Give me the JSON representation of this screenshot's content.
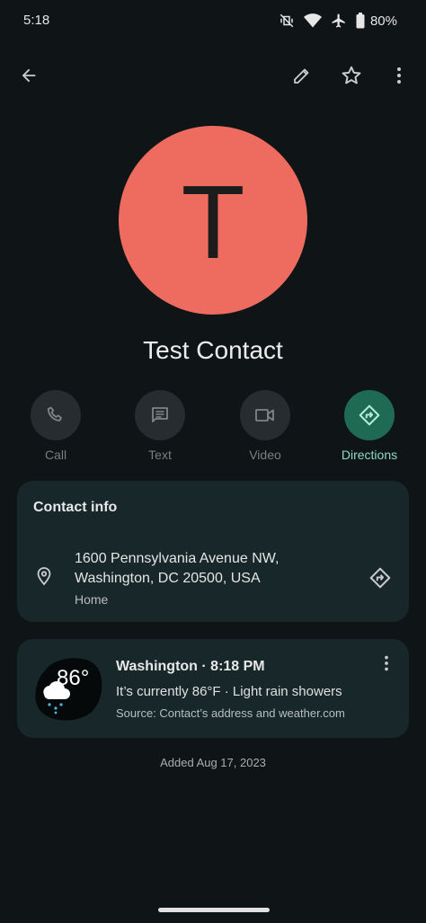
{
  "status_bar": {
    "time": "5:18",
    "battery": "80%"
  },
  "top_bar": {
    "back_icon": "arrow-back-icon",
    "edit_icon": "pencil-icon",
    "star_icon": "star-outline-icon",
    "more_icon": "more-vert-icon"
  },
  "contact": {
    "initial": "T",
    "name": "Test Contact",
    "avatar_color": "#ee6b5f"
  },
  "actions": [
    {
      "label": "Call",
      "icon": "phone-icon"
    },
    {
      "label": "Text",
      "icon": "message-icon"
    },
    {
      "label": "Video",
      "icon": "videocam-icon"
    },
    {
      "label": "Directions",
      "icon": "directions-icon",
      "active": true
    }
  ],
  "contact_info": {
    "title": "Contact info",
    "address_line1": "1600 Pennsylvania Avenue NW,",
    "address_line2": "Washington, DC 20500, USA",
    "address_type": "Home"
  },
  "weather": {
    "temperature": "86°",
    "title": "Washington · 8:18 PM",
    "description": "It’s currently 86°F · Light rain showers",
    "source": "Source: Contact’s address and weather.com",
    "icon": "rain-cloud-icon"
  },
  "footer": {
    "added": "Added Aug 17, 2023"
  },
  "colors": {
    "background": "#0f1416",
    "card": "#17272a",
    "accent": "#8edcc0",
    "accent_bg": "#1f6a52"
  }
}
